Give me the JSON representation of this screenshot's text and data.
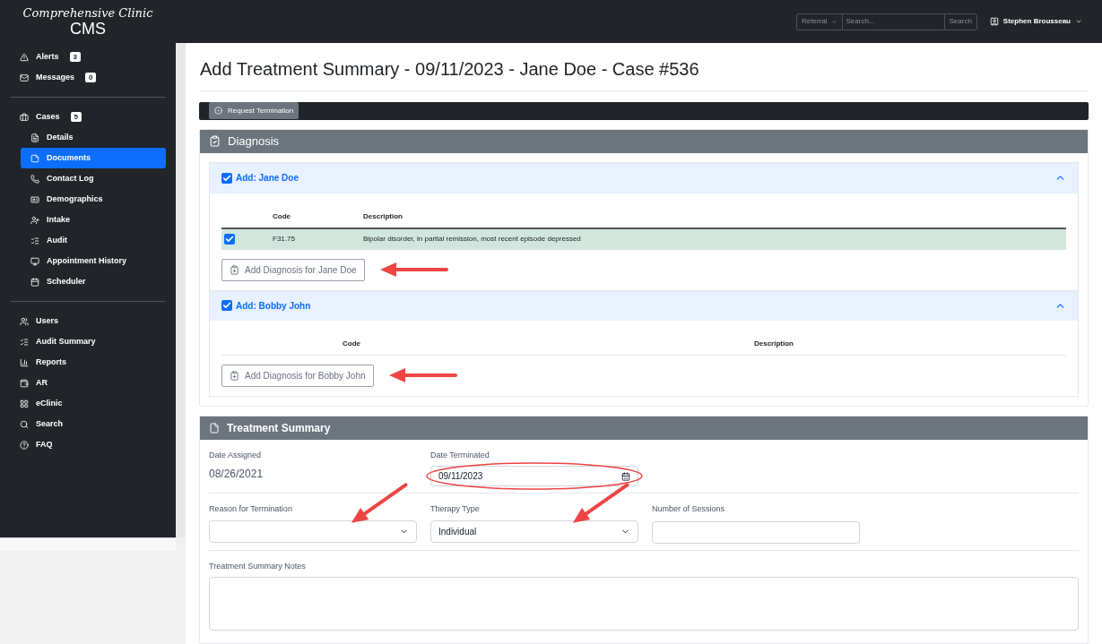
{
  "header": {
    "logo_script": "Comprehensive Clinic",
    "logo": "CMS",
    "search": {
      "dropdown": "Referral",
      "placeholder": "Search...",
      "button": "Search"
    },
    "user": "Stephen Brousseau"
  },
  "sidebar": {
    "groups": [
      {
        "items": [
          {
            "label": "Alerts",
            "badge": "3",
            "selected": false
          },
          {
            "label": "Messages",
            "badge": "0",
            "selected": false
          }
        ]
      },
      {
        "items": [
          {
            "label": "Cases",
            "badge": "5",
            "selected": false,
            "children": [
              {
                "label": "Details",
                "selected": false
              },
              {
                "label": "Documents",
                "selected": true
              },
              {
                "label": "Contact Log",
                "selected": false
              },
              {
                "label": "Demographics",
                "selected": false
              },
              {
                "label": "Intake",
                "selected": false
              },
              {
                "label": "Audit",
                "selected": false
              },
              {
                "label": "Appointment History",
                "selected": false
              },
              {
                "label": "Scheduler",
                "selected": false
              }
            ]
          }
        ]
      },
      {
        "items": [
          {
            "label": "Users",
            "selected": false
          },
          {
            "label": "Audit Summary",
            "selected": false
          },
          {
            "label": "Reports",
            "selected": false
          },
          {
            "label": "AR",
            "selected": false
          },
          {
            "label": "eClinic",
            "selected": false
          },
          {
            "label": "Search",
            "selected": false
          },
          {
            "label": "FAQ",
            "selected": false
          }
        ]
      }
    ]
  },
  "page_title": "Add Treatment Summary - 09/11/2023 - Jane Doe - Case #536",
  "toolbar": {
    "button": "Request Termination"
  },
  "diagnosis": {
    "title": "Diagnosis",
    "groups": [
      {
        "title": "Add: Jane Doe",
        "checked": true,
        "expanded": true,
        "columns": [
          "Code",
          "Description"
        ],
        "rows": [
          {
            "checked": true,
            "selected": true,
            "code": "F31.75",
            "description": "Bipolar disorder, in partial remission, most recent episode depressed"
          }
        ],
        "add_button": "Add Diagnosis for Jane Doe"
      },
      {
        "title": "Add: Bobby John",
        "checked": true,
        "expanded": true,
        "columns": [
          "Code",
          "Description"
        ],
        "add_button": "Add Diagnosis for Bobby John"
      }
    ]
  },
  "treatment_summary": {
    "title": "Treatment Summary",
    "rows": [
      [
        {
          "kind": "static",
          "label": "Date Assigned",
          "value": "08/26/2021"
        },
        {
          "kind": "date",
          "label": "Date Terminated",
          "value": "09/11/2023"
        }
      ],
      [
        {
          "kind": "select",
          "label": "Reason for Termination"
        },
        {
          "kind": "select",
          "label": "Therapy Type",
          "value": "Individual"
        },
        {
          "kind": "text",
          "label": "Number of Sessions"
        }
      ],
      [
        {
          "kind": "textarea",
          "label": "Treatment Summary Notes"
        }
      ]
    ]
  }
}
